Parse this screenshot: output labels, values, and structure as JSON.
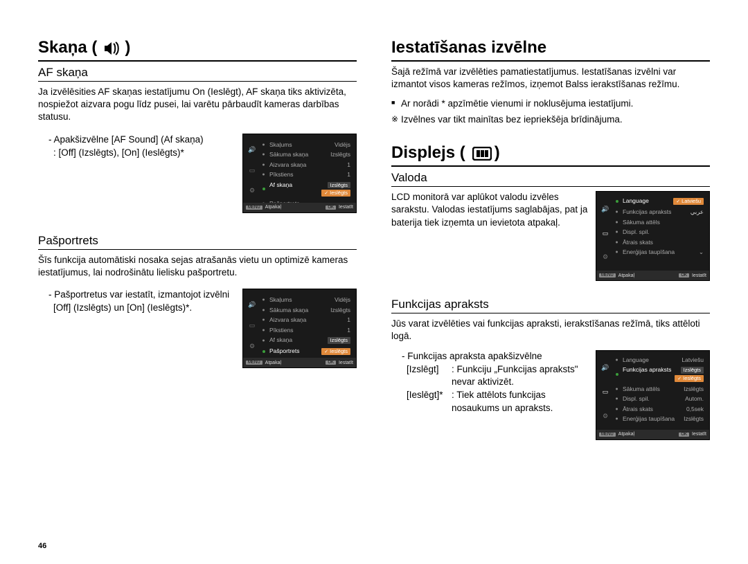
{
  "left": {
    "title_pre": "Skaņa (",
    "title_post": " )",
    "af": {
      "heading": "AF skaņa",
      "p": "Ja izvēlēsities AF skaņas iestatījumu On (Ieslēgt), AF skaņa tiks aktivizēta, nospiežot aizvara pogu līdz pusei, lai varētu pārbaudīt kameras darbības statusu.",
      "sub1": "- Apakšizvēlne [AF Sound] (Af skaņa)",
      "sub2": ": [Off] (Izslēgts), [On] (Ieslēgts)*"
    },
    "self": {
      "heading": "Pašportrets",
      "p": "Šīs funkcija automātiski nosaka sejas atrašanās vietu un optimizē kameras iestatījumus, lai nodrošinātu lielisku pašportretu.",
      "sub1": "- Pašportretus var iestatīt, izmantojot izvēlni",
      "sub2": "[Off] (Izslēgts) un [On] (Ieslēgts)*."
    }
  },
  "right": {
    "settings": {
      "title": "Iestatīšanas izvēlne",
      "p": "Šajā režīmā var izvēlēties pamatiestatījumus. Iestatīšanas izvēlni var izmantot visos kameras režīmos, izņemot Balss ierakstīšanas režīmu.",
      "b1": "Ar norādi * apzīmētie vienumi ir noklusējuma iestatījumi.",
      "b2": "Izvēlnes var tikt mainītas bez iepriekšēja brīdinājuma."
    },
    "display": {
      "title_pre": "Displejs (",
      "title_post": " )"
    },
    "lang": {
      "heading": "Valoda",
      "p": "LCD monitorā var aplūkot valodu izvēles sarakstu. Valodas iestatījums saglabājas, pat ja baterija tiek izņemta un ievietota atpakaļ."
    },
    "func": {
      "heading": "Funkcijas apraksts",
      "p": "Jūs varat izvēlēties vai funkcijas apraksti, ierakstīšanas režīmā, tiks attēloti logā.",
      "sub": "- Funkcijas apraksta apakšizvēlne",
      "off_l": "[Izslēgt]",
      "off_r": ": Funkciju „Funkcijas apraksts\" nevar aktivizēt.",
      "on_l": "[Ieslēgt]*",
      "on_r": ": Tiek attēlots funkcijas nosaukums un apraksts."
    }
  },
  "lcd_sound": {
    "rows": [
      {
        "l": "Skaļums",
        "r": "Vidējs"
      },
      {
        "l": "Sākuma skaņa",
        "r": "Izslēgts"
      },
      {
        "l": "Aizvara skaņa",
        "r": "1"
      },
      {
        "l": "Pīkstiens",
        "r": "1"
      },
      {
        "l": "Af skaņa",
        "r": ""
      },
      {
        "l": "Pašportrets",
        "r": ""
      }
    ],
    "active_index": 4,
    "popup1": "Izslēgts",
    "popup2": "Ieslēgts",
    "foot_back": "Atpakaļ",
    "foot_set": "Iestatīt",
    "menu_btn": "MENU",
    "ok_btn": "OK"
  },
  "lcd_sound2": {
    "active_index": 5
  },
  "lcd_disp": {
    "rows": [
      {
        "l": "Language",
        "r": "Latviešu"
      },
      {
        "l": "Funkcijas apraksts",
        "r": "عربي"
      },
      {
        "l": "Sākuma attēls",
        "r": ""
      },
      {
        "l": "Displ. spil.",
        "r": ""
      },
      {
        "l": "Ātrais skats",
        "r": ""
      },
      {
        "l": "Enerģijas taupīšana",
        "r": ""
      }
    ],
    "popup1": "Latviešu",
    "foot_back": "Atpakaļ",
    "foot_set": "Iestatīt",
    "menu_btn": "MENU",
    "ok_btn": "OK"
  },
  "lcd_disp2": {
    "rows": [
      {
        "l": "Language",
        "r": "Latviešu"
      },
      {
        "l": "Funkcijas apraksts",
        "r": ""
      },
      {
        "l": "Sākuma attēls",
        "r": "Izslēgts"
      },
      {
        "l": "Displ. spil.",
        "r": "Autom."
      },
      {
        "l": "Ātrais skats",
        "r": "0,5sek"
      },
      {
        "l": "Enerģijas taupīšana",
        "r": "Izslēgts"
      }
    ],
    "popup1": "Izslēgts",
    "popup2": "Ieslēgts"
  },
  "page_number": "46"
}
